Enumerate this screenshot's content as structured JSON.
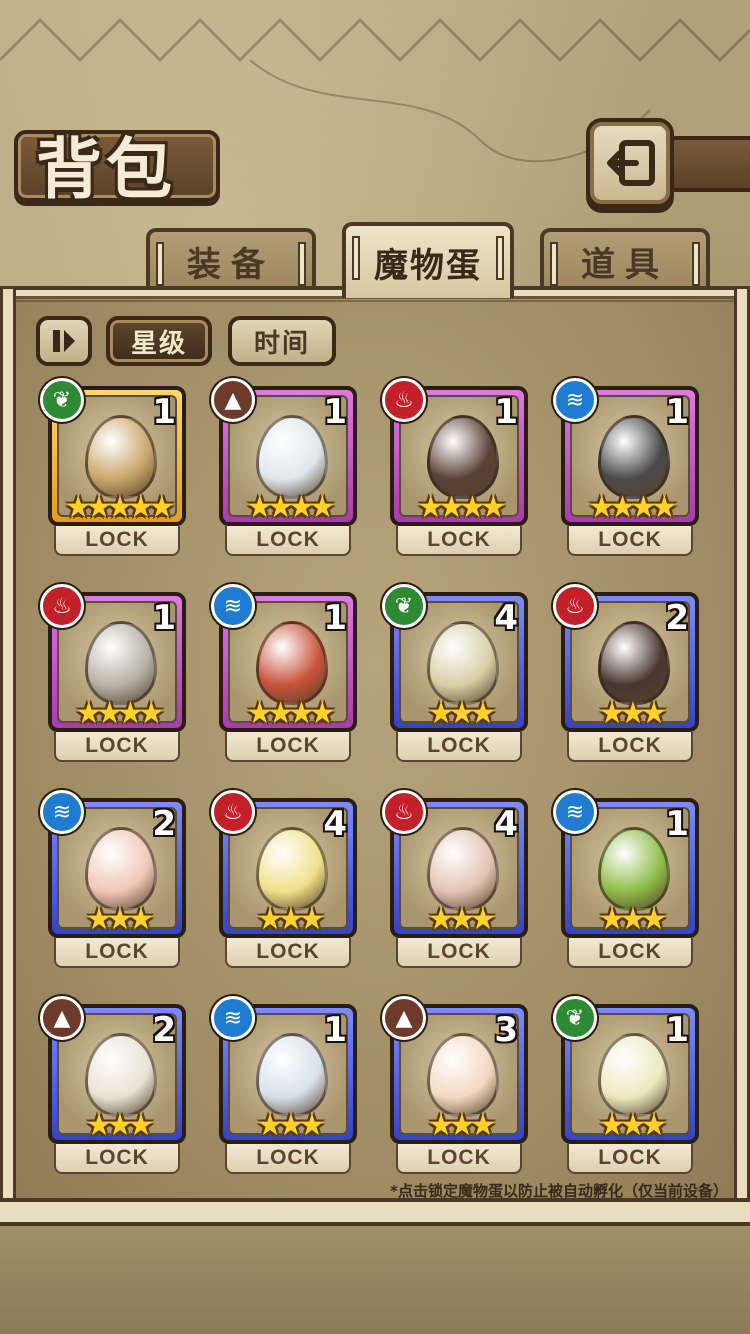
{
  "header": {
    "title": "背包"
  },
  "tabs": [
    {
      "label": "装备",
      "active": false
    },
    {
      "label": "魔物蛋",
      "active": true
    },
    {
      "label": "道具",
      "active": false
    }
  ],
  "sort": {
    "star_label": "星级",
    "time_label": "时间",
    "active": "星级"
  },
  "eggs": [
    {
      "element": "nature",
      "count": "1",
      "stars": "★★★★★",
      "rarity": "gold",
      "lock": "LOCK",
      "color": "#c9a66a"
    },
    {
      "element": "earth",
      "count": "1",
      "stars": "★★★★",
      "rarity": "purple",
      "lock": "LOCK",
      "color": "#dfe6ec"
    },
    {
      "element": "fire",
      "count": "1",
      "stars": "★★★★",
      "rarity": "purple",
      "lock": "LOCK",
      "color": "#5a4036"
    },
    {
      "element": "water",
      "count": "1",
      "stars": "★★★★",
      "rarity": "purple",
      "lock": "LOCK",
      "color": "#4b4a4a"
    },
    {
      "element": "fire",
      "count": "1",
      "stars": "★★★★",
      "rarity": "purple",
      "lock": "LOCK",
      "color": "#b7b2a7"
    },
    {
      "element": "water",
      "count": "1",
      "stars": "★★★★",
      "rarity": "purple",
      "lock": "LOCK",
      "color": "#c8533a"
    },
    {
      "element": "nature",
      "count": "4",
      "stars": "★★★",
      "rarity": "blue",
      "lock": "LOCK",
      "color": "#d6cfa6"
    },
    {
      "element": "fire",
      "count": "2",
      "stars": "★★★",
      "rarity": "blue",
      "lock": "LOCK",
      "color": "#4a3630"
    },
    {
      "element": "water",
      "count": "2",
      "stars": "★★★",
      "rarity": "blue",
      "lock": "LOCK",
      "color": "#f0c7b8"
    },
    {
      "element": "fire",
      "count": "4",
      "stars": "★★★",
      "rarity": "blue",
      "lock": "LOCK",
      "color": "#f1e08a"
    },
    {
      "element": "fire",
      "count": "4",
      "stars": "★★★",
      "rarity": "blue",
      "lock": "LOCK",
      "color": "#e4c3b3"
    },
    {
      "element": "water",
      "count": "1",
      "stars": "★★★",
      "rarity": "blue",
      "lock": "LOCK",
      "color": "#8fbd4a"
    },
    {
      "element": "earth",
      "count": "2",
      "stars": "★★★",
      "rarity": "blue",
      "lock": "LOCK",
      "color": "#e9e2d4"
    },
    {
      "element": "water",
      "count": "1",
      "stars": "★★★",
      "rarity": "blue",
      "lock": "LOCK",
      "color": "#d7e0ea"
    },
    {
      "element": "earth",
      "count": "3",
      "stars": "★★★",
      "rarity": "blue",
      "lock": "LOCK",
      "color": "#f4d8c2"
    },
    {
      "element": "nature",
      "count": "1",
      "stars": "★★★",
      "rarity": "blue",
      "lock": "LOCK",
      "color": "#ece9bf"
    }
  ],
  "footnote": "*点击锁定魔物蛋以防止被自动孵化（仅当前设备）",
  "element_icons": {
    "nature": "leaf-icon",
    "earth": "mountain-icon",
    "fire": "flame-icon",
    "water": "wave-icon"
  },
  "element_glyphs": {
    "nature": "❦",
    "earth": "▲",
    "fire": "♨",
    "water": "≋"
  },
  "colors": {
    "frame": "#4b3826",
    "parchment": "#e9ddbf",
    "star": "#ffd22a"
  }
}
